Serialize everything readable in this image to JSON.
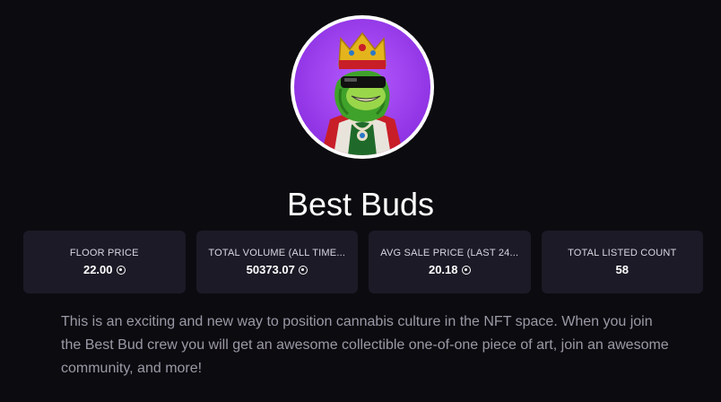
{
  "collection": {
    "name": "Best Buds",
    "avatar_alt": "Best Buds collection avatar"
  },
  "stats": [
    {
      "label": "FLOOR PRICE",
      "value": "22.00",
      "icon": "sol-icon"
    },
    {
      "label": "TOTAL VOLUME (ALL TIME...",
      "value": "50373.07",
      "icon": "sol-icon"
    },
    {
      "label": "AVG SALE PRICE (LAST 24...",
      "value": "20.18",
      "icon": "sol-icon"
    },
    {
      "label": "TOTAL LISTED COUNT",
      "value": "58",
      "icon": ""
    }
  ],
  "description": "This is an exciting and new way to position cannabis culture in the NFT space. When you join the Best Bud crew you will get an awesome collectible one-of-one piece of art, join an awesome community, and more!",
  "colors": {
    "background": "#0c0b10",
    "card": "#1c1a26",
    "avatar_bg": "#a040f0",
    "muted_text": "#9c99a6"
  }
}
